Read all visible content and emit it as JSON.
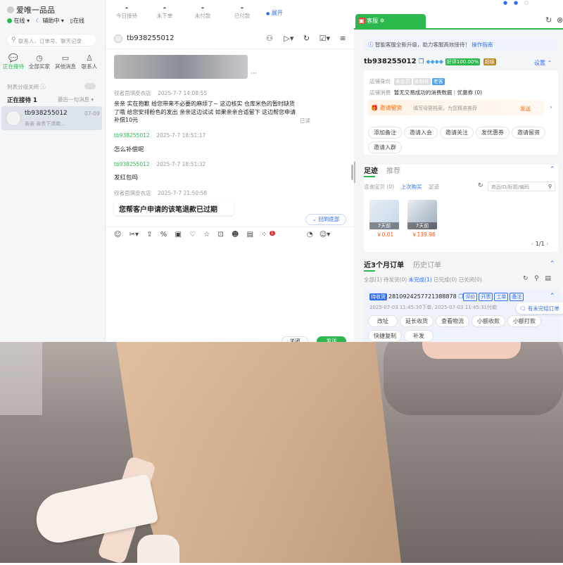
{
  "app": {
    "logo_title": "爱唯一品品",
    "status_online": "在线",
    "status_assist": "辅助中",
    "status_online2": "在线",
    "stats": [
      {
        "value": "-",
        "label": "今日接待"
      },
      {
        "value": "-",
        "label": "未下单"
      },
      {
        "value": "-",
        "label": "未付款"
      },
      {
        "value": "-",
        "label": "已付款"
      }
    ],
    "expand": "展开"
  },
  "left": {
    "search_placeholder": "联系人、订单号、聊天记录",
    "tabs": [
      {
        "label": "正在接待"
      },
      {
        "label": "全部买家"
      },
      {
        "label": "其他消息"
      },
      {
        "label": "联系人"
      }
    ],
    "group_toggle": "列表分组关闭",
    "receiving": "正在接待",
    "receiving_count": "1",
    "sort": "最后一句消息",
    "contact": {
      "name": "tb938255012",
      "time": "07-09",
      "preview": "亲亲 亲贵下退款..."
    }
  },
  "chat": {
    "contact_name": "tb938255012",
    "messages": [
      {
        "sender": "钗者茴琪皮衣店",
        "time": "2025-7-7 14:08:55",
        "text": "亲亲 实在抱歉 给您带来不必要的麻烦了~ 这边核实 仓库米色的暂时缺货了哦 给您安排粉色的发出 亲亲这边试试 如果亲亲合适留下 这边帮您申请补偿10元",
        "status": "已读"
      },
      {
        "sender": "tb938255012",
        "time": "2025-7-7 18:51:17",
        "text": "怎么补偿呢"
      },
      {
        "sender": "tb938255012",
        "time": "2025-7-7 18:51:32",
        "text": "发红包吗"
      },
      {
        "sender": "钗者茴琪皮衣店",
        "time": "2025-7-7 21:50:58",
        "text": "您帮客户申请的该笔退款已过期"
      }
    ],
    "back_to_bottom": "回到底部",
    "close_btn": "关闭",
    "send_btn": "发送",
    "badge": "1"
  },
  "right": {
    "tab": "客服",
    "notice": "智能客服全新升级，助力客服高效接待！",
    "notice_link": "操作指南",
    "buyer": "tb938255012",
    "good_rate": "好评100.00%",
    "level": "超级",
    "settings": "设置",
    "identity_label": "店铺身份",
    "identity_tags": [
      "未会员",
      "未粉丝",
      "老客"
    ],
    "spend_label": "店铺消费",
    "spend_text": "暂无交易成功的消费数据",
    "coupon": "优惠券 (0)",
    "invite_title": "邀请留资",
    "invite_desc": "填写母婴档案，为您精准推荐",
    "invite_send": "发送",
    "actions": [
      "添加备注",
      "邀请入会",
      "邀请关注",
      "发优惠券",
      "邀请留资",
      "邀请入群"
    ],
    "trace_tab": "足迹",
    "recommend_tab": "推荐",
    "trace_sub": [
      "咨询宝贝 (0)",
      "上次购买",
      "足迹"
    ],
    "goods_search": "商品ID/标题/编码",
    "goods": [
      {
        "tag": "7天前",
        "price": "￥0.01"
      },
      {
        "tag": "7天前",
        "price": "￥139.98"
      }
    ],
    "pager": "1/1",
    "orders_tab": "近3个月订单",
    "history_tab": "历史订单",
    "order_filters": [
      "全部(1)",
      "待发货(0)",
      "未完成(1)",
      "已完成(0)",
      "已关闭(0)"
    ],
    "order_status": "待收货",
    "order_no": "2810924257721388878",
    "order_tags": [
      "评价",
      "开票",
      "工单",
      "备注"
    ],
    "order_time": "2025-07-03 11:45:30下单, 2025-07-03 11:45:31付款",
    "order_btns": [
      "改址",
      "延长收货",
      "查看物流",
      "小额收款",
      "小额打款",
      "快捷复制",
      "补发"
    ],
    "unfinished": "有未完结订单"
  },
  "colors": {
    "green": "#2db84d",
    "blue": "#2f6df4",
    "orange": "#ff6a00"
  }
}
